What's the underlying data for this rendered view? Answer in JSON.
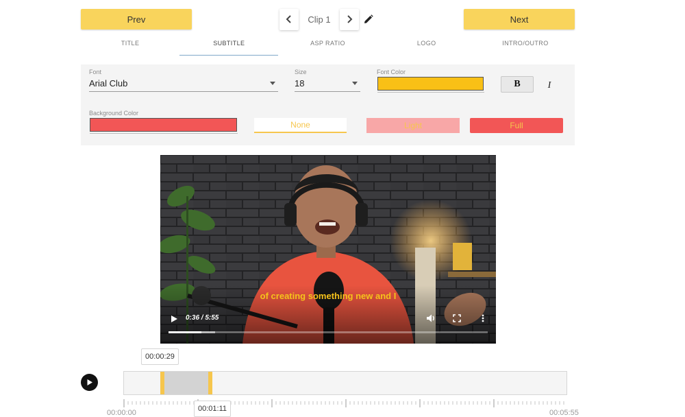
{
  "nav": {
    "prev_label": "Prev",
    "next_label": "Next",
    "clip_label": "Clip 1"
  },
  "tabs": [
    {
      "label": "TITLE",
      "active": false
    },
    {
      "label": "SUBTITLE",
      "active": true
    },
    {
      "label": "ASP RATIO",
      "active": false
    },
    {
      "label": "LOGO",
      "active": false
    },
    {
      "label": "INTRO/OUTRO",
      "active": false
    }
  ],
  "subtitle_settings": {
    "font_label": "Font",
    "font_value": "Arial Club",
    "size_label": "Size",
    "size_value": "18",
    "font_color_label": "Font Color",
    "font_color": "#f9c016",
    "bold_label": "B",
    "italic_label": "I",
    "background_color_label": "Background Color",
    "background_color": "#f25656",
    "bg_options": [
      {
        "label": "None",
        "color": "#f6c64d"
      },
      {
        "label": "Light",
        "color": "#f8a7a7"
      },
      {
        "label": "Full",
        "color": "#f25656"
      }
    ]
  },
  "video": {
    "subtitle_text": "of creating something new and I",
    "time_display": "0:36 / 5:55",
    "progress": 0.103,
    "buffered": 0.145
  },
  "timeline": {
    "start_tooltip": "00:00:29",
    "end_tooltip": "00:01:11",
    "start_time": "00:00:00",
    "end_time": "00:05:55",
    "selection_start": 0.082,
    "selection_end": 0.2
  },
  "icons": {
    "prev_clip": "chevron-left-icon",
    "next_clip": "chevron-right-icon",
    "edit": "pencil-icon",
    "play": "play-icon",
    "volume": "volume-icon",
    "fullscreen": "fullscreen-icon",
    "more": "more-vertical-icon"
  }
}
